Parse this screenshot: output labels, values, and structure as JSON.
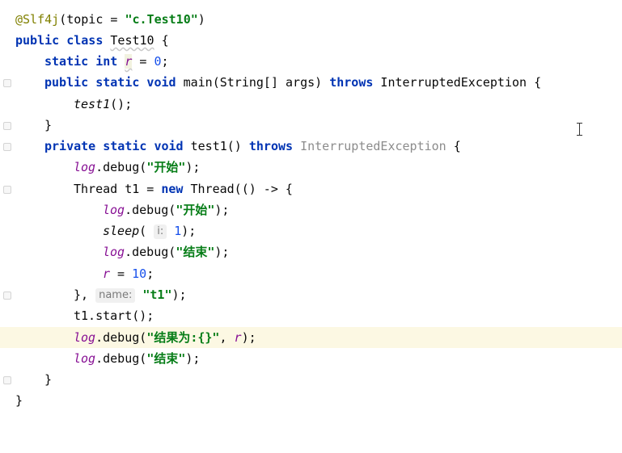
{
  "code": {
    "l1": {
      "ann": "@Slf4j",
      "open": "(topic = ",
      "str": "\"c.Test10\"",
      "close": ")"
    },
    "l2": {
      "kw": "public class",
      "sp": " ",
      "name": "Test10",
      "rest": " {"
    },
    "l3": {
      "kw": "static int",
      "sp": " ",
      "var": "r",
      "eq": " = ",
      "num": "0",
      "semi": ";"
    },
    "l4": {
      "kw1": "public static void",
      "mid": " main(String[] args) ",
      "kw2": "throws",
      "rest": " InterruptedException {"
    },
    "l5": {
      "call": "test1",
      "rest": "();"
    },
    "l6": {
      "text": "}"
    },
    "l7": {
      "kw1": "private static void",
      "mid": " test1() ",
      "kw2": "throws",
      "sp": " ",
      "unused": "InterruptedException",
      "rest": " {"
    },
    "l8": {
      "log": "log",
      "call": ".debug(",
      "str": "\"开始\"",
      "rest": ");"
    },
    "l9": {
      "a": "Thread t1 = ",
      "kw": "new",
      "b": " Thread(() -> {"
    },
    "l10": {
      "log": "log",
      "call": ".debug(",
      "str": "\"开始\"",
      "rest": ");"
    },
    "l11": {
      "call": "sleep",
      "open": "( ",
      "hint": "i:",
      "num": "1",
      "rest": ");"
    },
    "l12": {
      "log": "log",
      "call": ".debug(",
      "str": "\"结束\"",
      "rest": ");"
    },
    "l13": {
      "var": "r",
      "eq": " = ",
      "num": "10",
      "semi": ";"
    },
    "l14": {
      "a": "}, ",
      "hint": "name:",
      "sp": " ",
      "str": "\"t1\"",
      "rest": ");"
    },
    "l15": {
      "text": "t1.start();"
    },
    "l16": {
      "log": "log",
      "call": ".debug(",
      "str": "\"结果为:{}\"",
      "comma": ", ",
      "var": "r",
      "rest": ");"
    },
    "l17": {
      "log": "log",
      "call": ".debug(",
      "str": "\"结束\"",
      "rest": ");"
    },
    "l18": {
      "text": "}"
    },
    "l19": {
      "text": "}"
    }
  }
}
